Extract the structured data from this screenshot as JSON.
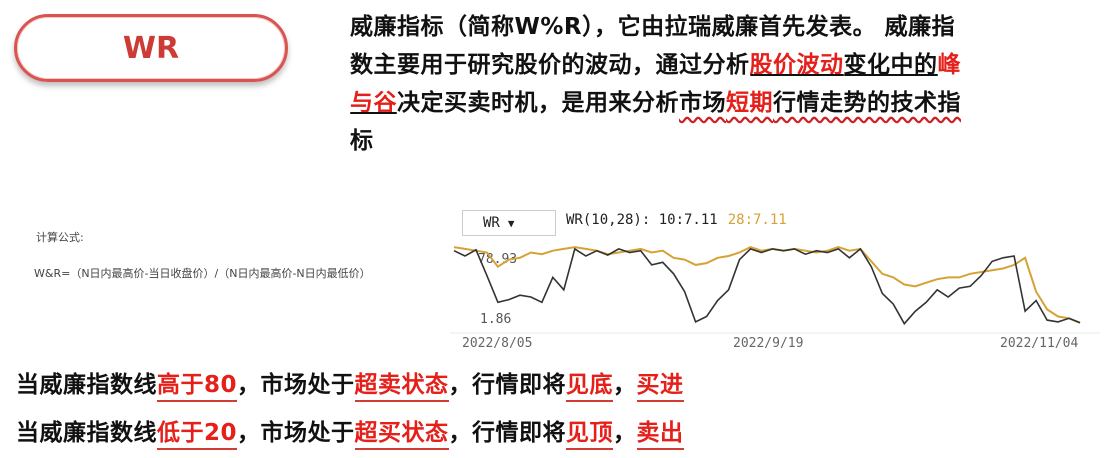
{
  "title": "WR",
  "paragraph": {
    "l1": "威廉指标（简称W%R），它由拉瑞威廉首先发表。 威廉指",
    "l2a": "数主要用于研究股价的波动，通过分析",
    "l2b": "股价波动",
    "l2c": "变化中的",
    "l2d": "峰",
    "l3a": "与谷",
    "l3b": "决定买卖时机，是用来分析",
    "l3c": "市场",
    "l3d": "短期",
    "l3e": "行情走势的技术指",
    "l4": "标"
  },
  "formula": {
    "title": "计算公式:",
    "text": "W&R=（N日内最高价-当日收盘价）/（N日内最高价-N日内最低价）"
  },
  "chart": {
    "selector": "WR",
    "legend_prefix": "WR(10,28): 10:7.11",
    "legend_s2": "28:7.11",
    "top_label": "78.93",
    "bottom_label": "1.86",
    "x_ticks": [
      "2022/8/05",
      "2022/9/19",
      "2022/11/04"
    ],
    "colors": {
      "s1": "#333333",
      "s2": "#d6a236"
    }
  },
  "chart_data": {
    "type": "line",
    "x": [
      "2022/8/05",
      "2022/9/19",
      "2022/11/04"
    ],
    "series": [
      {
        "name": "10",
        "values": [
          88,
          82,
          89,
          60,
          30,
          33,
          38,
          36,
          30,
          58,
          44,
          90,
          82,
          88,
          83,
          90,
          86,
          88,
          72,
          75,
          62,
          42,
          8,
          14,
          32,
          44,
          78,
          90,
          86,
          90,
          88,
          90,
          84,
          88,
          86,
          90,
          80,
          90,
          70,
          40,
          28,
          6,
          20,
          30,
          44,
          36,
          46,
          48,
          60,
          76,
          80,
          82,
          20,
          32,
          10,
          8,
          12,
          7
        ]
      },
      {
        "name": "28",
        "values": [
          92,
          90,
          88,
          86,
          70,
          78,
          80,
          86,
          84,
          88,
          90,
          92,
          90,
          88,
          84,
          86,
          88,
          90,
          86,
          88,
          80,
          78,
          72,
          74,
          80,
          82,
          86,
          92,
          88,
          90,
          88,
          90,
          88,
          86,
          88,
          92,
          88,
          90,
          76,
          62,
          58,
          50,
          48,
          52,
          56,
          58,
          58,
          62,
          64,
          66,
          68,
          72,
          80,
          42,
          22,
          14,
          12,
          7
        ]
      }
    ],
    "ylim": [
      0,
      100
    ]
  },
  "bottom": {
    "a1": "当威廉指数线",
    "a2": "高于80",
    "a3": "，市场处于",
    "a4": "超卖状态",
    "a5": "，行情即将",
    "a6": "见底",
    "a7": "，",
    "a8": "买进",
    "b1": "当威廉指数线",
    "b2": "低于20",
    "b3": "，市场处于",
    "b4": "超买状态",
    "b5": "，行情即将",
    "b6": "见顶",
    "b7": "，",
    "b8": "卖出"
  }
}
